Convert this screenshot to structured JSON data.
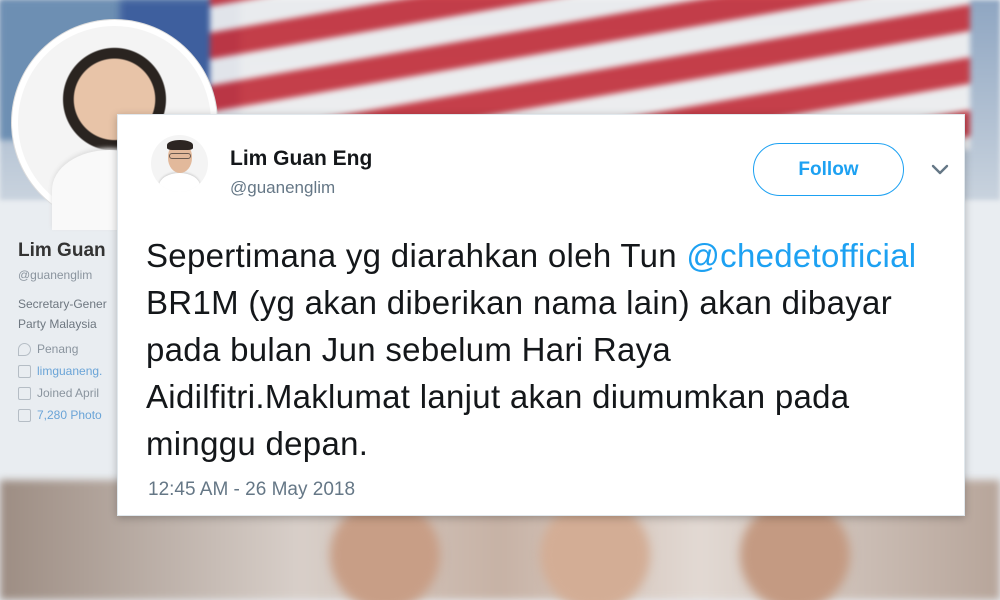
{
  "background_profile": {
    "name": "Lim Guan",
    "handle": "@guanenglim",
    "bio_line1": "Secretary-Gener",
    "bio_line2": "Party Malaysia",
    "location": "Penang",
    "website": "limguaneng.",
    "joined": "Joined April",
    "photos": "7,280 Photo"
  },
  "tweet": {
    "author_name": "Lim Guan Eng",
    "author_handle": "@guanenglim",
    "follow_label": "Follow",
    "text_before_mention": "Sepertimana yg diarahkan oleh Tun ",
    "mention": "@chedetofficial",
    "text_after_mention": " BR1M (yg akan diberikan nama lain) akan dibayar pada bulan Jun sebelum Hari Raya Aidilfitri.Maklumat lanjut akan diumumkan pada minggu depan.",
    "timestamp": "12:45 AM - 26 May 2018"
  },
  "colors": {
    "accent": "#1da1f2",
    "text_primary": "#14171a",
    "text_secondary": "#657786"
  },
  "icons": {
    "menu": "chevron-down-icon"
  }
}
